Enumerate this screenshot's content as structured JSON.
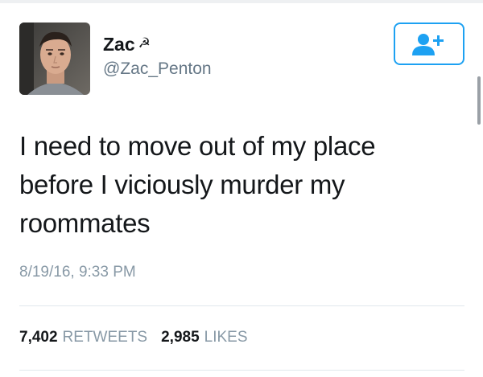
{
  "profile": {
    "display_name": "Zac",
    "name_emoji": "☭",
    "handle": "@Zac_Penton",
    "avatar_icon": "avatar-photo"
  },
  "follow_button": {
    "icon": "add-user-icon",
    "color": "#1da1f2"
  },
  "tweet": {
    "line1": "I need to move out of my place",
    "line2": "before I viciously murder my",
    "line3": "roommates",
    "timestamp": "8/19/16, 9:33 PM"
  },
  "stats": {
    "retweets_count": "7,402",
    "retweets_label": "RETWEETS",
    "likes_count": "2,985",
    "likes_label": "LIKES"
  },
  "colors": {
    "accent": "#1da1f2",
    "secondary_text": "#8899a6",
    "primary_text": "#14171a"
  }
}
